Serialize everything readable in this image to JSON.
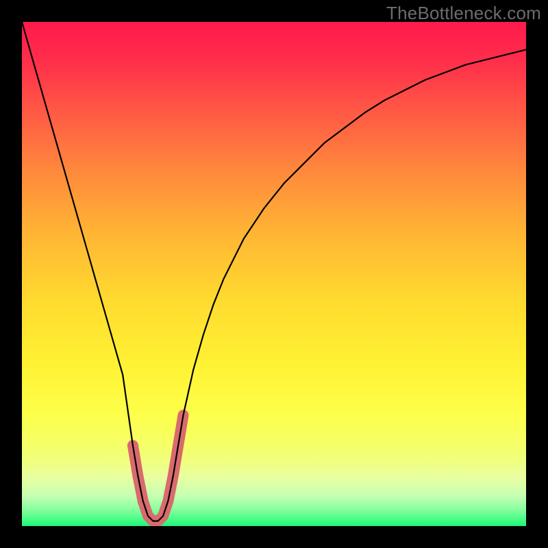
{
  "watermark": "TheBottleneck.com",
  "chart_data": {
    "type": "line",
    "title": "",
    "xlabel": "",
    "ylabel": "",
    "xlim": [
      0,
      100
    ],
    "ylim": [
      0,
      100
    ],
    "series": [
      {
        "name": "bottleneck-curve",
        "x": [
          0,
          2,
          4,
          6,
          8,
          10,
          12,
          14,
          16,
          18,
          20,
          22,
          23,
          24,
          25,
          26,
          27,
          28,
          29,
          30,
          31,
          32,
          34,
          36,
          38,
          40,
          44,
          48,
          52,
          56,
          60,
          64,
          68,
          72,
          76,
          80,
          84,
          88,
          92,
          96,
          100
        ],
        "y": [
          100,
          93,
          86,
          79,
          72,
          65,
          58,
          51,
          44,
          37,
          30,
          16,
          10,
          5,
          2,
          1,
          1,
          2,
          5,
          10,
          16,
          22,
          31,
          38,
          44,
          49,
          57,
          63,
          68,
          72,
          76,
          79,
          82,
          84.5,
          86.5,
          88.5,
          90,
          91.5,
          92.5,
          93.5,
          94.5
        ]
      }
    ],
    "optimal_region": {
      "x_range": [
        22,
        32
      ],
      "note": "highlighted bottom of curve"
    },
    "background_gradient": {
      "stops": [
        {
          "offset": 0.0,
          "color": "#ff1a4b"
        },
        {
          "offset": 0.08,
          "color": "#ff2f4b"
        },
        {
          "offset": 0.18,
          "color": "#ff5a44"
        },
        {
          "offset": 0.3,
          "color": "#ff8a3c"
        },
        {
          "offset": 0.42,
          "color": "#ffb534"
        },
        {
          "offset": 0.55,
          "color": "#ffda2f"
        },
        {
          "offset": 0.68,
          "color": "#fff233"
        },
        {
          "offset": 0.78,
          "color": "#fdff4a"
        },
        {
          "offset": 0.86,
          "color": "#f2ff74"
        },
        {
          "offset": 0.905,
          "color": "#e8ffa2"
        },
        {
          "offset": 0.94,
          "color": "#c5ffb2"
        },
        {
          "offset": 0.965,
          "color": "#8effa0"
        },
        {
          "offset": 0.985,
          "color": "#4dfd89"
        },
        {
          "offset": 1.0,
          "color": "#1ef579"
        }
      ]
    }
  }
}
